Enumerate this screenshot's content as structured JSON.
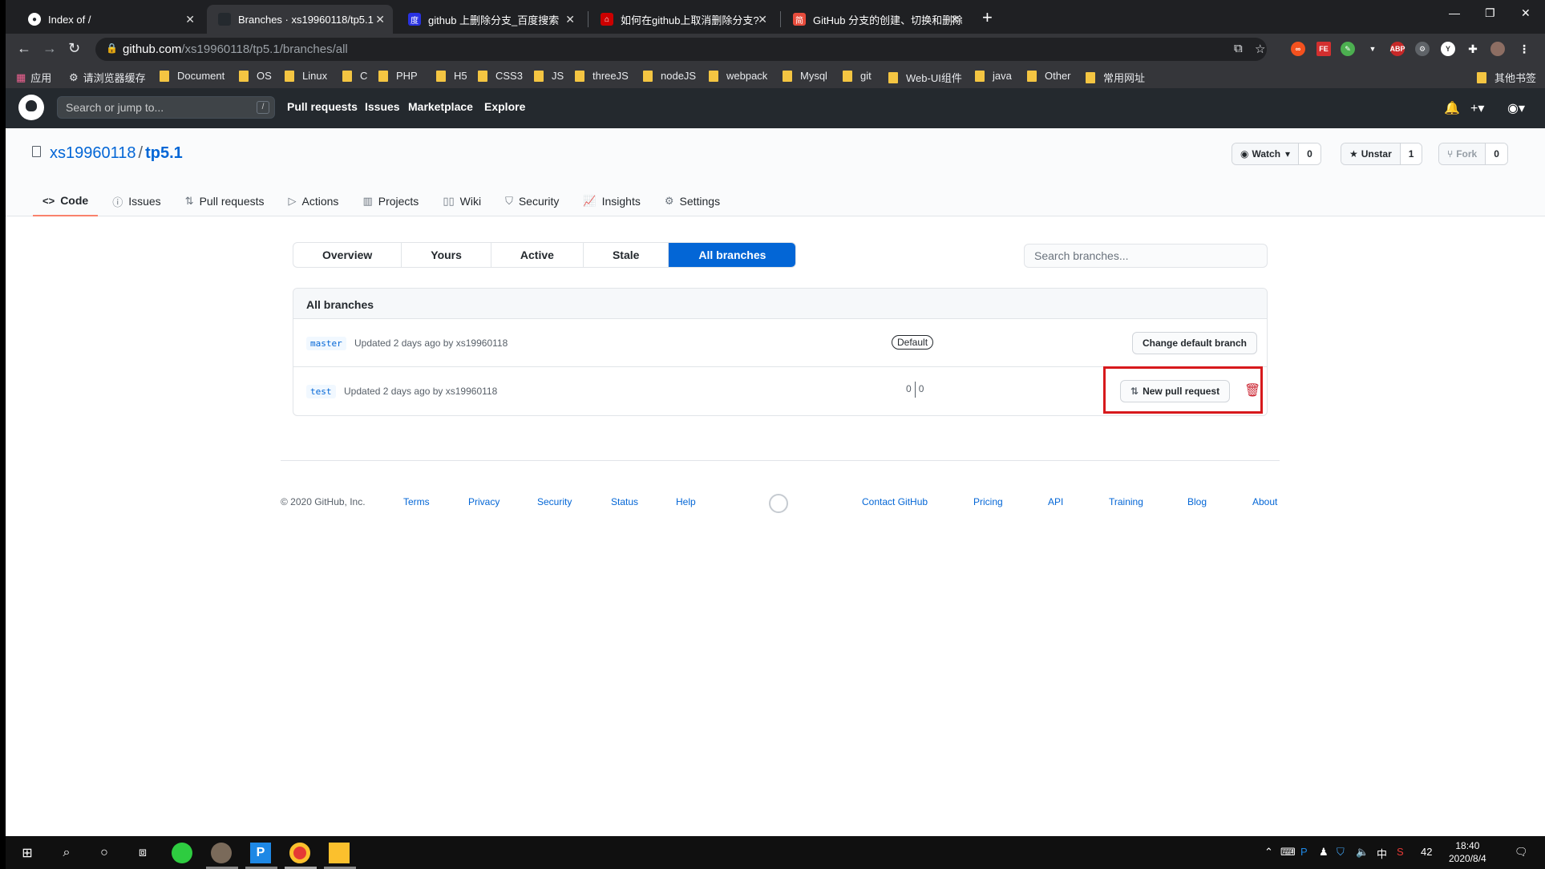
{
  "browser": {
    "tabs": [
      {
        "title": "Index of /",
        "active": false
      },
      {
        "title": "Branches · xs19960118/tp5.1",
        "active": true
      },
      {
        "title": "github 上删除分支_百度搜索",
        "active": false
      },
      {
        "title": "如何在github上取消删除分支?",
        "active": false
      },
      {
        "title": "GitHub 分支的创建、切换和删除",
        "active": false
      }
    ],
    "url_host": "github.com",
    "url_path": "/xs19960118/tp5.1/branches/all",
    "bookmarks": [
      "应用",
      "请浏览器缓存",
      "Document",
      "OS",
      "Linux",
      "C",
      "PHP",
      "H5",
      "CSS3",
      "JS",
      "threeJS",
      "nodeJS",
      "webpack",
      "Mysql",
      "git",
      "Web-UI组件",
      "java",
      "Other",
      "常用网址"
    ],
    "other_bookmarks": "其他书签"
  },
  "github": {
    "search_placeholder": "Search or jump to...",
    "search_key": "/",
    "nav": [
      "Pull requests",
      "Issues",
      "Marketplace",
      "Explore"
    ]
  },
  "repo": {
    "owner": "xs19960118",
    "separator": "/",
    "name": "tp5.1",
    "watch_label": "Watch",
    "watch_count": "0",
    "star_label": "Unstar",
    "star_count": "1",
    "fork_label": "Fork",
    "fork_count": "0",
    "tabs": [
      "Code",
      "Issues",
      "Pull requests",
      "Actions",
      "Projects",
      "Wiki",
      "Security",
      "Insights",
      "Settings"
    ]
  },
  "branches": {
    "filters": [
      "Overview",
      "Yours",
      "Active",
      "Stale",
      "All branches"
    ],
    "selected_filter": "All branches",
    "search_placeholder": "Search branches...",
    "box_title": "All branches",
    "rows": [
      {
        "name": "master",
        "updated": "Updated 2 days ago by xs19960118",
        "badge": "Default",
        "action": "Change default branch"
      },
      {
        "name": "test",
        "updated": "Updated 2 days ago by xs19960118",
        "behind": "0",
        "ahead": "0",
        "action": "New pull request"
      }
    ]
  },
  "footer": {
    "copyright": "© 2020 GitHub, Inc.",
    "left_links": [
      "Terms",
      "Privacy",
      "Security",
      "Status",
      "Help"
    ],
    "right_links": [
      "Contact GitHub",
      "Pricing",
      "API",
      "Training",
      "Blog",
      "About"
    ]
  },
  "taskbar": {
    "time": "18:40",
    "date": "2020/8/4",
    "ime": "中",
    "tray_num": "42"
  },
  "colors": {
    "accent": "#0366d6",
    "highlight": "#d7191c",
    "tab_underline": "#f9826c",
    "header": "#24292e"
  }
}
